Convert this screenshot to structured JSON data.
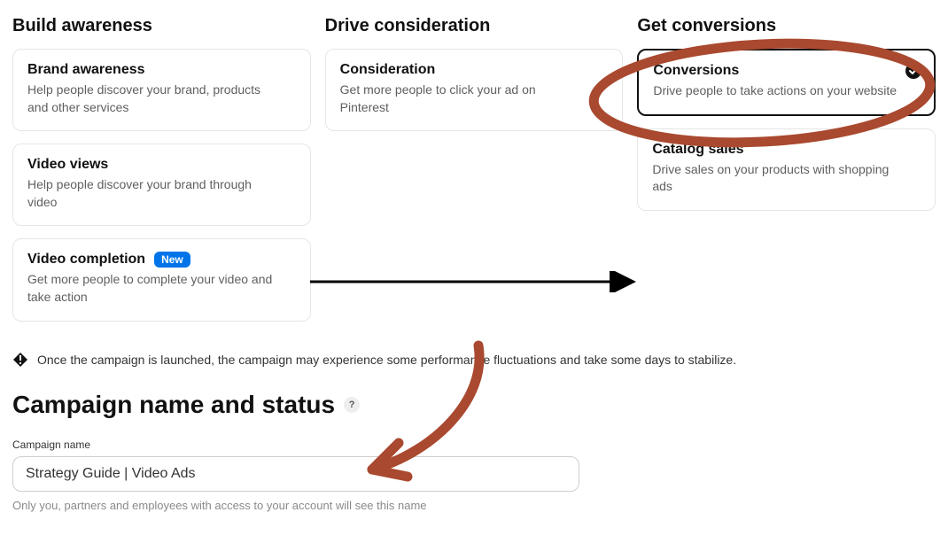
{
  "columns": [
    {
      "heading": "Build awareness",
      "cards": {
        "brand_awareness": {
          "title": "Brand awareness",
          "desc": "Help people discover your brand, products and other services"
        },
        "video_views": {
          "title": "Video views",
          "desc": "Help people discover your brand through video"
        },
        "video_completion": {
          "title": "Video completion",
          "desc": "Get more people to complete your video and take action",
          "badge": "New"
        }
      }
    },
    {
      "heading": "Drive consideration",
      "cards": {
        "consideration": {
          "title": "Consideration",
          "desc": "Get more people to click your ad on Pinterest"
        }
      }
    },
    {
      "heading": "Get conversions",
      "cards": {
        "conversions": {
          "title": "Conversions",
          "desc": "Drive people to take actions on your website"
        },
        "catalog_sales": {
          "title": "Catalog sales",
          "desc": "Drive sales on your products with shopping ads"
        }
      }
    }
  ],
  "info_banner": "Once the campaign is launched, the campaign may experience some performance fluctuations and take some days to stabilize.",
  "section_heading": "Campaign name and status",
  "help_glyph": "?",
  "campaign_name": {
    "label": "Campaign name",
    "value": "Strategy Guide | Video Ads",
    "help": "Only you, partners and employees with access to your account will see this name"
  },
  "annotation_color": "#a9492f"
}
